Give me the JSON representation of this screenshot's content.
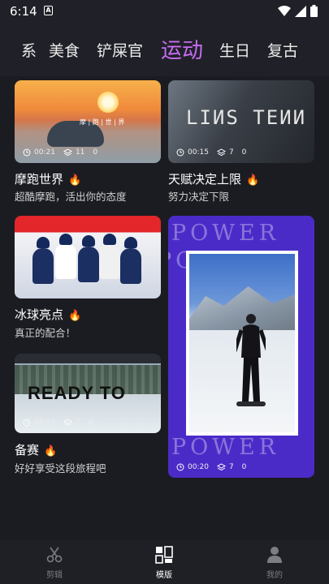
{
  "status": {
    "time": "6:14"
  },
  "tabs": [
    "系",
    "美食",
    "铲屎官",
    "运动",
    "生日",
    "复古"
  ],
  "active_tab": "运动",
  "accent_color": "#c86cf2",
  "templates": [
    {
      "title": "摩跑世界",
      "subtitle": "超酷摩跑，活出你的态度",
      "duration": "00:21",
      "layers": "11",
      "count": "0",
      "caption": "摩 | 跑 | 世 | 界"
    },
    {
      "title": "天赋决定上限",
      "subtitle": "努力决定下限",
      "duration": "00:15",
      "layers": "7",
      "count": "0",
      "caption": "LIИS TEИИ"
    },
    {
      "title": "冰球亮点",
      "subtitle": "真正的配合！"
    },
    {
      "title": "备赛",
      "subtitle": "好好享受这段旅程吧",
      "duration": "00:19",
      "layers": "7",
      "count": "0",
      "caption": "READY TO"
    },
    {
      "duration": "00:20",
      "layers": "7",
      "count": "0",
      "caption": "POWER"
    }
  ],
  "bottom_nav": [
    {
      "label": "剪辑",
      "icon": "scissors-icon"
    },
    {
      "label": "模版",
      "icon": "template-icon"
    },
    {
      "label": "我的",
      "icon": "profile-icon"
    }
  ]
}
